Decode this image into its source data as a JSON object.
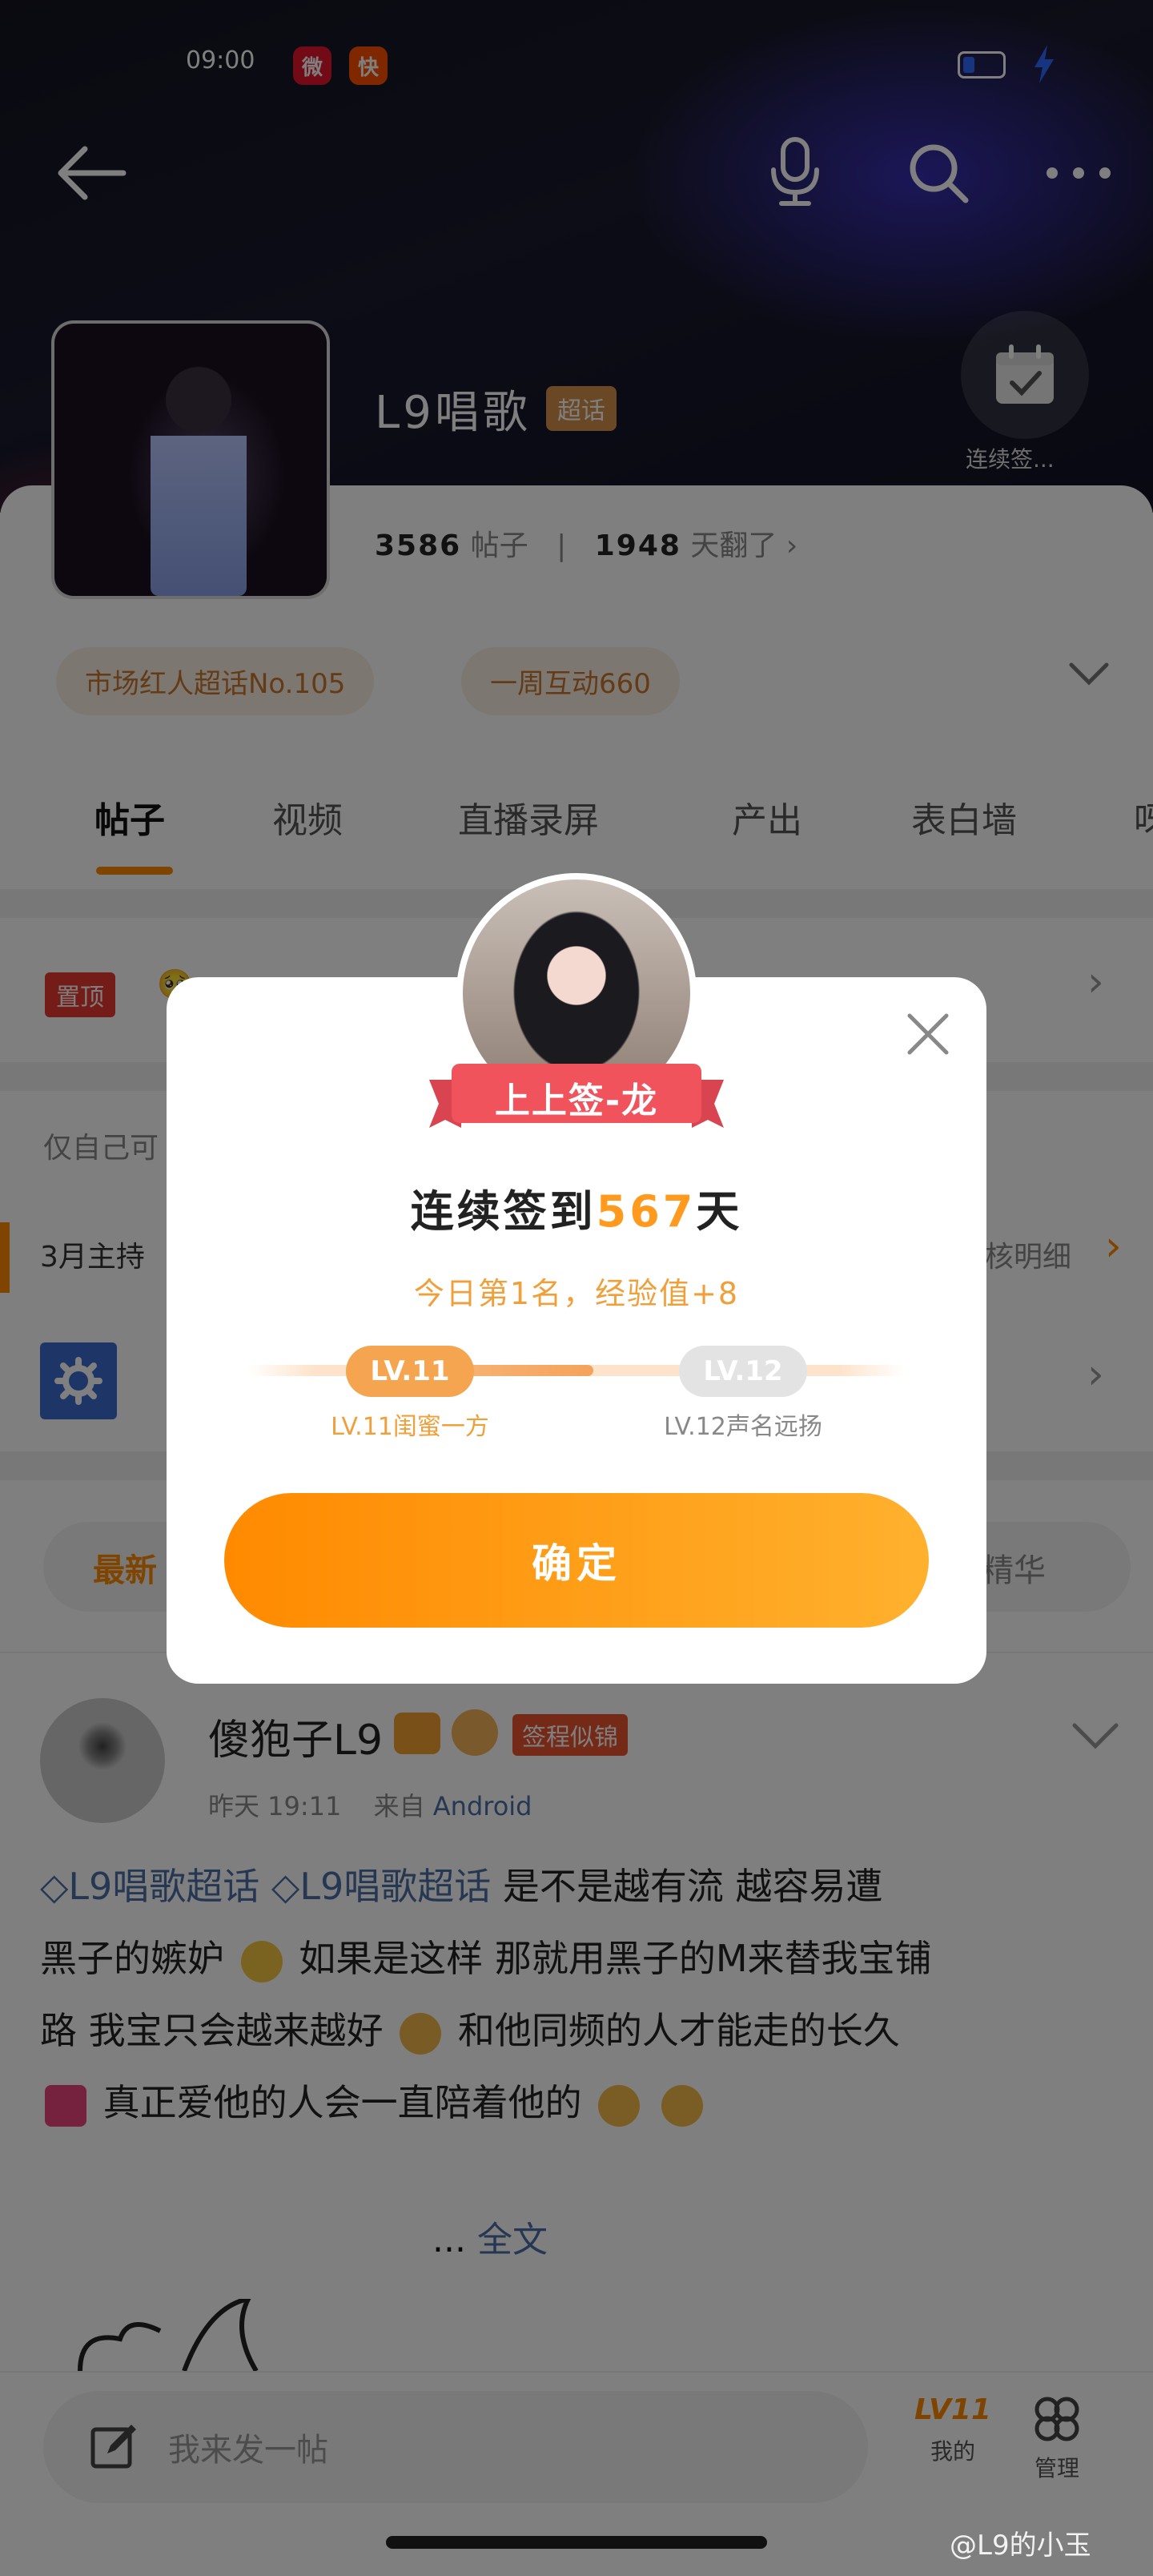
{
  "status_bar": {
    "time": "09:00",
    "apps": [
      {
        "icon": "weibo-icon",
        "color": "#e6162d",
        "glyph": "微"
      },
      {
        "icon": "kuaishou-icon",
        "color": "#ff5000",
        "glyph": "快"
      }
    ],
    "battery_color": "#2f6bff",
    "charging_color": "#2f6bff"
  },
  "header": {
    "back_icon": "back-arrow-icon",
    "mic_icon": "microphone-icon",
    "search_icon": "search-icon",
    "more_icon": "more-icon"
  },
  "topic": {
    "name": "L9唱歌",
    "badge": "超话",
    "signin_label": "连续签...",
    "posts_count": "3586",
    "posts_label": "帖子",
    "fans_count": "1948",
    "fans_label": "天翻了",
    "pills": [
      "市场红人超话No.105",
      "一周互动660"
    ]
  },
  "tabs": [
    "帖子",
    "视频",
    "直播录屏",
    "产出",
    "表白墙",
    "呀"
  ],
  "active_tab": "帖子",
  "pinned": {
    "badge": "置顶",
    "text": "🥺"
  },
  "rows": {
    "visibility_text": "仅自己可",
    "monthly_text": "3月主持",
    "monthly_right": "核明细"
  },
  "feed_tabs": {
    "latest": "最新",
    "featured": "精华"
  },
  "post": {
    "author": "傻狍子L9",
    "author_badge": "签程似锦",
    "time": "昨天 19:11",
    "source_prefix": "来自",
    "source": "Android",
    "tag1": "L9唱歌超话",
    "tag2": "L9唱歌超话",
    "line1": "是不是越有流 越容易遭",
    "line2a": "黑子的嫉妒",
    "line2b": "如果是这样 那就用黑子的M来替我宝铺",
    "line3a": "路 我宝只会越来越好",
    "line3b": "和他同频的人才能走的长久",
    "line4": "真正爱他的人会一直陪着他的",
    "more_dots": "...",
    "more_link": "全文"
  },
  "bottom": {
    "compose_placeholder": "我来发一帖",
    "mine_level": "LV11",
    "mine_label": "我的",
    "manage_label": "管理"
  },
  "modal": {
    "ribbon": "上上签-龙",
    "title_prefix": "连续签到",
    "days": "567",
    "title_suffix": "天",
    "subtitle": "今日第1名，经验值+8",
    "level_current": "LV.11",
    "level_next": "LV.12",
    "level_current_caption": "LV.11闺蜜一方",
    "level_next_caption": "LV.12声名远扬",
    "progress": 0.55,
    "confirm": "确定",
    "close_icon": "close-icon"
  },
  "watermark": "@L9的小玉",
  "colors": {
    "accent": "#ff8a00",
    "accent_light": "#ffb12e",
    "ribbon": "#f0535c",
    "tag": "#4a6fa5"
  }
}
